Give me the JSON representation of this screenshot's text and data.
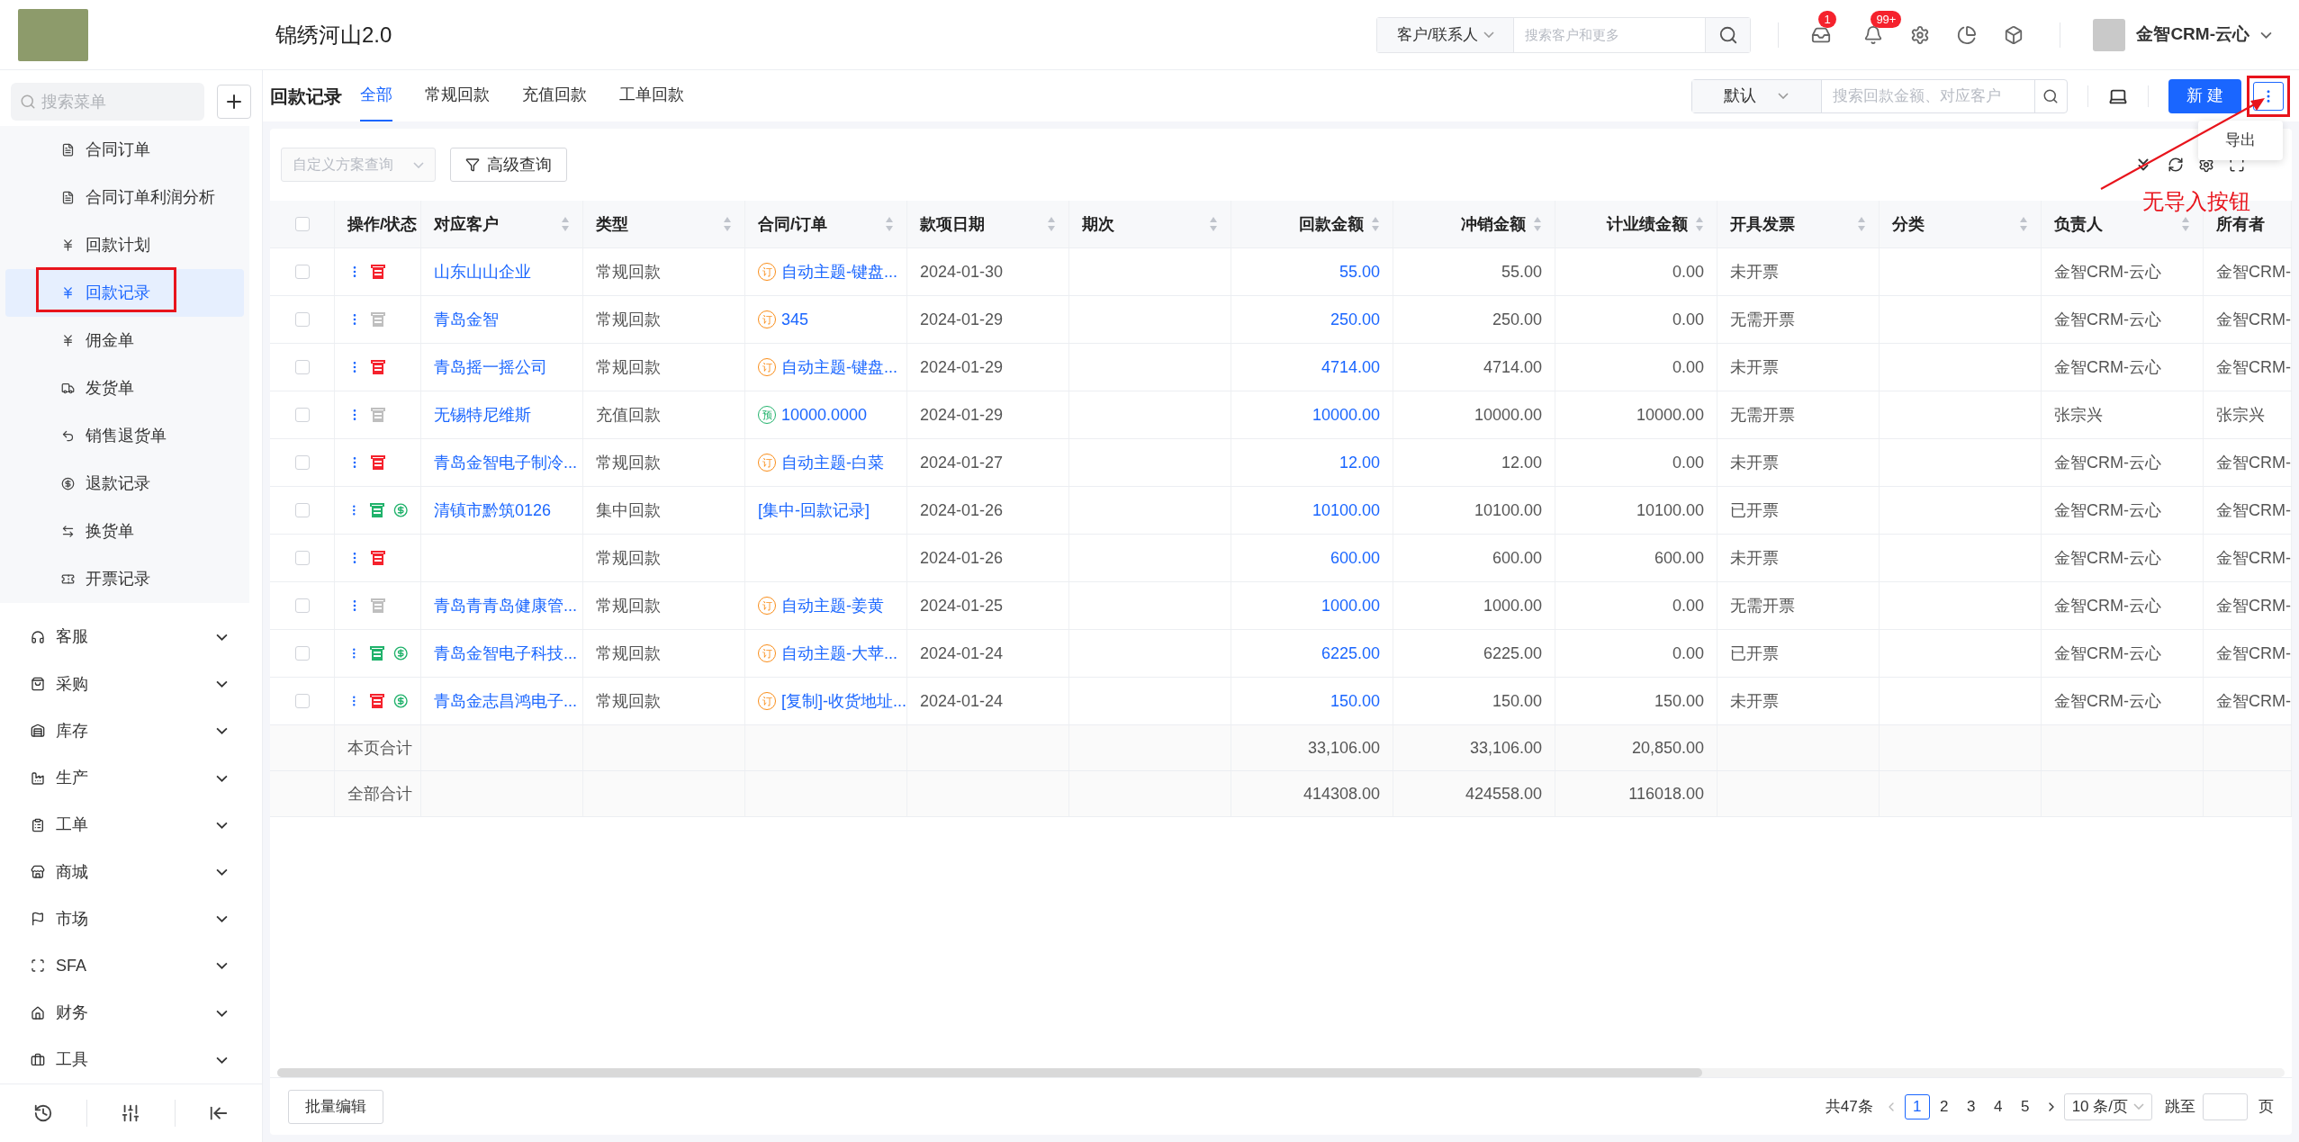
{
  "header": {
    "title": "锦绣河山2.0",
    "search_scope": "客户/联系人",
    "search_placeholder": "搜索客户和更多",
    "badges": [
      "1",
      "99+"
    ],
    "user": "金智CRM-云心"
  },
  "sidebar": {
    "search_placeholder": "搜索菜单",
    "sub_items": [
      {
        "label": "合同订单",
        "selected": false
      },
      {
        "label": "合同订单利润分析",
        "selected": false
      },
      {
        "label": "回款计划",
        "selected": false
      },
      {
        "label": "回款记录",
        "selected": true
      },
      {
        "label": "佣金单",
        "selected": false
      },
      {
        "label": "发货单",
        "selected": false
      },
      {
        "label": "销售退货单",
        "selected": false
      },
      {
        "label": "退款记录",
        "selected": false
      },
      {
        "label": "换货单",
        "selected": false
      },
      {
        "label": "开票记录",
        "selected": false
      }
    ],
    "groups": [
      "客服",
      "采购",
      "库存",
      "生产",
      "工单",
      "商城",
      "市场",
      "SFA",
      "财务",
      "工具"
    ]
  },
  "page": {
    "title": "回款记录",
    "tabs": [
      {
        "label": "全部",
        "selected": true
      },
      {
        "label": "常规回款",
        "selected": false
      },
      {
        "label": "充值回款",
        "selected": false
      },
      {
        "label": "工单回款",
        "selected": false
      }
    ],
    "view_select": "默认",
    "search_placeholder": "搜索回款金额、对应客户",
    "new_button": "新 建",
    "menu_items": [
      "导出"
    ]
  },
  "filters": {
    "scheme_placeholder": "自定义方案查询",
    "advanced_button": "高级查询"
  },
  "table": {
    "select_all": {
      "checked": false
    },
    "columns": [
      {
        "label": "操作/状态",
        "sortable": false
      },
      {
        "label": "对应客户",
        "sortable": true
      },
      {
        "label": "类型",
        "sortable": true
      },
      {
        "label": "合同/订单",
        "sortable": true
      },
      {
        "label": "款项日期",
        "sortable": true
      },
      {
        "label": "期次",
        "sortable": true
      },
      {
        "label": "回款金额",
        "sortable": true
      },
      {
        "label": "冲销金额",
        "sortable": true
      },
      {
        "label": "计业绩金额",
        "sortable": true
      },
      {
        "label": "开具发票",
        "sortable": true
      },
      {
        "label": "分类",
        "sortable": true
      },
      {
        "label": "负责人",
        "sortable": true
      },
      {
        "label": "所有者",
        "sortable": false
      }
    ],
    "rows": [
      {
        "checked": false,
        "color": "#f5222d",
        "refund": false,
        "customer": "山东山山企业",
        "type": "常规回款",
        "contract": {
          "kind": "order",
          "badge": "订",
          "text": "自动主题-键盘..."
        },
        "date": "2024-01-30",
        "amount": "55.00",
        "writeoff": "55.00",
        "performance": "0.00",
        "invoice": "未开票",
        "owner": "金智CRM-云心",
        "creator": "金智CRM-"
      },
      {
        "checked": false,
        "color": "#bfbfbf",
        "refund": false,
        "customer": "青岛金智",
        "type": "常规回款",
        "contract": {
          "kind": "order",
          "badge": "订",
          "text": "345"
        },
        "date": "2024-01-29",
        "amount": "250.00",
        "writeoff": "250.00",
        "performance": "0.00",
        "invoice": "无需开票",
        "owner": "金智CRM-云心",
        "creator": "金智CRM-"
      },
      {
        "checked": false,
        "color": "#f5222d",
        "refund": false,
        "customer": "青岛摇一摇公司",
        "type": "常规回款",
        "contract": {
          "kind": "order",
          "badge": "订",
          "text": "自动主题-键盘..."
        },
        "date": "2024-01-29",
        "amount": "4714.00",
        "writeoff": "4714.00",
        "performance": "0.00",
        "invoice": "未开票",
        "owner": "金智CRM-云心",
        "creator": "金智CRM-"
      },
      {
        "checked": false,
        "color": "#bfbfbf",
        "refund": false,
        "customer": "无锡特尼维斯",
        "type": "充值回款",
        "contract": {
          "kind": "prepaid",
          "badge": "预",
          "text": "10000.0000"
        },
        "date": "2024-01-29",
        "amount": "10000.00",
        "writeoff": "10000.00",
        "performance": "10000.00",
        "invoice": "无需开票",
        "owner": "张宗兴",
        "creator": "张宗兴"
      },
      {
        "checked": false,
        "color": "#f5222d",
        "refund": false,
        "customer": "青岛金智电子制冷...",
        "type": "常规回款",
        "contract": {
          "kind": "order",
          "badge": "订",
          "text": "自动主题-白菜"
        },
        "date": "2024-01-27",
        "amount": "12.00",
        "writeoff": "12.00",
        "performance": "0.00",
        "invoice": "未开票",
        "owner": "金智CRM-云心",
        "creator": "金智CRM-"
      },
      {
        "checked": false,
        "color": "#20b26b",
        "refund": true,
        "customer": "清镇市黔筑0126",
        "type": "集中回款",
        "contract": {
          "kind": "plain",
          "text": "[集中-回款记录]"
        },
        "date": "2024-01-26",
        "amount": "10100.00",
        "writeoff": "10100.00",
        "performance": "10100.00",
        "invoice": "已开票",
        "owner": "金智CRM-云心",
        "creator": "金智CRM-"
      },
      {
        "checked": false,
        "color": "#f5222d",
        "refund": false,
        "type": "常规回款",
        "date": "2024-01-26",
        "amount": "600.00",
        "writeoff": "600.00",
        "performance": "600.00",
        "invoice": "未开票",
        "owner": "金智CRM-云心",
        "creator": "金智CRM-"
      },
      {
        "checked": false,
        "color": "#bfbfbf",
        "refund": false,
        "customer": "青岛青青岛健康管...",
        "type": "常规回款",
        "contract": {
          "kind": "order",
          "badge": "订",
          "text": "自动主题-姜黄"
        },
        "date": "2024-01-25",
        "amount": "1000.00",
        "writeoff": "1000.00",
        "performance": "0.00",
        "invoice": "无需开票",
        "owner": "金智CRM-云心",
        "creator": "金智CRM-"
      },
      {
        "checked": false,
        "color": "#20b26b",
        "refund": true,
        "customer": "青岛金智电子科技...",
        "type": "常规回款",
        "contract": {
          "kind": "order",
          "badge": "订",
          "text": "自动主题-大苹..."
        },
        "date": "2024-01-24",
        "amount": "6225.00",
        "writeoff": "6225.00",
        "performance": "0.00",
        "invoice": "已开票",
        "owner": "金智CRM-云心",
        "creator": "金智CRM-"
      },
      {
        "checked": false,
        "color": "#f5222d",
        "refund": true,
        "customer": "青岛金志昌鸿电子...",
        "type": "常规回款",
        "contract": {
          "kind": "order",
          "badge": "订",
          "text": "[复制]-收货地址..."
        },
        "date": "2024-01-24",
        "amount": "150.00",
        "writeoff": "150.00",
        "performance": "150.00",
        "invoice": "未开票",
        "owner": "金智CRM-云心",
        "creator": "金智CRM-"
      }
    ],
    "totals": [
      {
        "label": "本页合计",
        "amount": "33,106.00",
        "writeoff": "33,106.00",
        "performance": "20,850.00"
      },
      {
        "label": "全部合计",
        "amount": "414308.00",
        "writeoff": "424558.00",
        "performance": "116018.00"
      }
    ]
  },
  "footer": {
    "batch_button": "批量编辑",
    "total": "共47条",
    "pages": [
      {
        "label": "1",
        "selected": true
      },
      {
        "label": "2",
        "selected": false
      },
      {
        "label": "3",
        "selected": false
      },
      {
        "label": "4",
        "selected": false
      },
      {
        "label": "5",
        "selected": false
      }
    ],
    "page_size": "10 条/页",
    "jump_label": "跳至",
    "page_unit": "页"
  },
  "annotation": {
    "text": "无导入按钮"
  }
}
